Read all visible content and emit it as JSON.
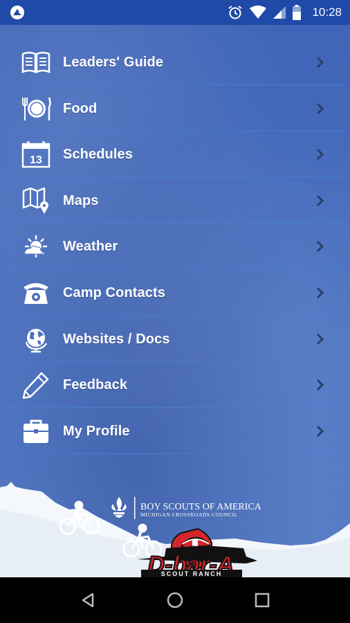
{
  "status_bar": {
    "time": "10:28",
    "icons": [
      "app-notification-icon",
      "alarm-icon",
      "wifi-icon",
      "cell-signal-icon",
      "battery-icon"
    ]
  },
  "menu": {
    "items": [
      {
        "label": "Leaders' Guide",
        "icon": "book-icon"
      },
      {
        "label": "Food",
        "icon": "plate-icon"
      },
      {
        "label": "Schedules",
        "icon": "calendar-icon",
        "icon_text": "13"
      },
      {
        "label": "Maps",
        "icon": "map-icon"
      },
      {
        "label": "Weather",
        "icon": "weather-icon"
      },
      {
        "label": "Camp Contacts",
        "icon": "phone-icon"
      },
      {
        "label": "Websites / Docs",
        "icon": "globe-icon"
      },
      {
        "label": "Feedback",
        "icon": "pencil-icon"
      },
      {
        "label": "My Profile",
        "icon": "briefcase-icon"
      }
    ]
  },
  "footer": {
    "bsa_title": "BOY SCOUTS OF AMERICA",
    "bsa_council": "MICHIGAN CROSSROADS COUNCIL",
    "logo_main": "D-bar-A",
    "logo_sub": "SCOUT RANCH",
    "logo_barn": "D-A"
  },
  "colors": {
    "status_bar": "#1f4aa8",
    "background": "#4a6fbe",
    "divider": "#4682d7",
    "logo_red": "#d4262b"
  }
}
